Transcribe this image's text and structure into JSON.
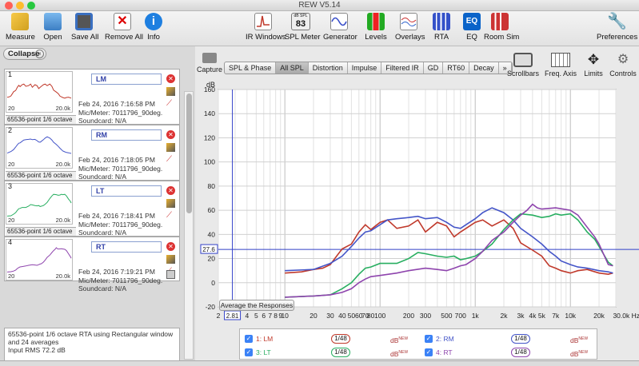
{
  "window": {
    "title": "REW V5.14"
  },
  "toolbar": {
    "measure": "Measure",
    "open": "Open",
    "save_all": "Save All",
    "remove_all": "Remove All",
    "info": "Info",
    "ir_windows": "IR Windows",
    "spl_meter": "SPL Meter",
    "spl_meter_value": "83",
    "spl_meter_unit": "dB SPL",
    "generator": "Generator",
    "levels": "Levels",
    "overlays": "Overlays",
    "rta": "RTA",
    "eq": "EQ",
    "eq_badge": "EQ",
    "room_sim": "Room Sim",
    "preferences": "Preferences"
  },
  "sidebar": {
    "collapse_label": "Collapse",
    "measurements": [
      {
        "index": "1",
        "name": "LM",
        "date": "Feb 24, 2016 7:16:58 PM",
        "mic": "Mic/Meter: 7011796_90deg.",
        "soundcard": "Soundcard: N/A",
        "desc": "65536-point 1/6 octave",
        "axis_lo": "20",
        "axis_hi": "20.0k",
        "color": "#c0392b"
      },
      {
        "index": "2",
        "name": "RM",
        "date": "Feb 24, 2016 7:18:05 PM",
        "mic": "Mic/Meter: 7011796_90deg.",
        "soundcard": "Soundcard: N/A",
        "desc": "65536-point 1/6 octave",
        "axis_lo": "20",
        "axis_hi": "20.0k",
        "color": "#4455c8"
      },
      {
        "index": "3",
        "name": "LT",
        "date": "Feb 24, 2016 7:18:41 PM",
        "mic": "Mic/Meter: 7011796_90deg.",
        "soundcard": "Soundcard: N/A",
        "desc": "65536-point 1/6 octave",
        "axis_lo": "20",
        "axis_hi": "20.0k",
        "color": "#27ae60"
      },
      {
        "index": "4",
        "name": "RT",
        "date": "Feb 24, 2016 7:19:21 PM",
        "mic": "Mic/Meter: 7011796_90deg.",
        "soundcard": "Soundcard: N/A",
        "axis_lo": "20",
        "axis_hi": "20.0k",
        "color": "#8e44ad"
      }
    ],
    "selected_info": {
      "line1": "65536-point 1/6 octave RTA using Rectangular window",
      "line2": "and 24 averages",
      "line3": "Input RMS 72.2 dB"
    }
  },
  "graph": {
    "capture": "Capture",
    "tabs": [
      "SPL & Phase",
      "All SPL",
      "Distortion",
      "Impulse",
      "Filtered IR",
      "GD",
      "RT60",
      "Decay",
      "»"
    ],
    "active_tab": "All SPL",
    "tools": {
      "scrollbars": "Scrollbars",
      "freq_axis": "Freq. Axis",
      "limits": "Limits",
      "controls": "Controls"
    },
    "cursor_y_label": "27.6",
    "cursor_x_label": "2.81",
    "average_button": "Average the Responses",
    "legend": [
      {
        "label": "1: LM",
        "smoothing": "1/48",
        "db": "dB",
        "db_sup": "NEW",
        "color": "#c0392b"
      },
      {
        "label": "2: RM",
        "smoothing": "1/48",
        "db": "dB",
        "db_sup": "NEW",
        "color": "#4455c8"
      },
      {
        "label": "3: LT",
        "smoothing": "1/48",
        "db": "dB",
        "db_sup": "NEW",
        "color": "#27ae60"
      },
      {
        "label": "4: RT",
        "smoothing": "1/48",
        "db": "dB",
        "db_sup": "NEW",
        "color": "#8e44ad"
      }
    ]
  },
  "chart_data": {
    "type": "line",
    "ylabel": "dB",
    "xlabel": "Hz",
    "xscale": "log",
    "xlim": [
      2,
      30000
    ],
    "ylim": [
      -20,
      160
    ],
    "grid": true,
    "x_ticks": [
      "2",
      "3",
      "4",
      "5",
      "6",
      "7",
      "8",
      "9",
      "10",
      "20",
      "30",
      "40",
      "50",
      "60",
      "70",
      "80",
      "100",
      "200",
      "300",
      "500",
      "700",
      "1k",
      "2k",
      "3k",
      "4k",
      "5k",
      "7k",
      "10k",
      "20k",
      "30.0k Hz"
    ],
    "y_ticks": [
      "160",
      "140",
      "120",
      "100",
      "80",
      "60",
      "40",
      "20",
      "0",
      "-20"
    ],
    "cursor": {
      "x": 2.81,
      "y": 27.6
    },
    "series": [
      {
        "name": "1: LM",
        "color": "#c0392b",
        "points": [
          [
            10,
            8
          ],
          [
            15,
            9
          ],
          [
            20,
            11
          ],
          [
            25,
            12
          ],
          [
            30,
            15
          ],
          [
            35,
            22
          ],
          [
            40,
            28
          ],
          [
            50,
            32
          ],
          [
            60,
            42
          ],
          [
            70,
            48
          ],
          [
            80,
            44
          ],
          [
            100,
            50
          ],
          [
            120,
            52
          ],
          [
            150,
            45
          ],
          [
            200,
            47
          ],
          [
            250,
            52
          ],
          [
            300,
            42
          ],
          [
            400,
            50
          ],
          [
            500,
            47
          ],
          [
            600,
            38
          ],
          [
            700,
            42
          ],
          [
            800,
            45
          ],
          [
            1000,
            50
          ],
          [
            1200,
            52
          ],
          [
            1500,
            47
          ],
          [
            2000,
            52
          ],
          [
            2500,
            45
          ],
          [
            3000,
            33
          ],
          [
            4000,
            27
          ],
          [
            5000,
            22
          ],
          [
            6000,
            14
          ],
          [
            7000,
            12
          ],
          [
            8000,
            10
          ],
          [
            10000,
            8
          ],
          [
            12000,
            10
          ],
          [
            15000,
            11
          ],
          [
            20000,
            8
          ],
          [
            25000,
            7
          ],
          [
            28000,
            8
          ]
        ]
      },
      {
        "name": "2: RM",
        "color": "#4455c8",
        "points": [
          [
            10,
            10
          ],
          [
            20,
            11
          ],
          [
            30,
            16
          ],
          [
            40,
            22
          ],
          [
            50,
            30
          ],
          [
            60,
            37
          ],
          [
            70,
            42
          ],
          [
            80,
            43
          ],
          [
            100,
            48
          ],
          [
            120,
            52
          ],
          [
            150,
            53
          ],
          [
            200,
            54
          ],
          [
            250,
            55
          ],
          [
            300,
            53
          ],
          [
            400,
            54
          ],
          [
            500,
            50
          ],
          [
            600,
            46
          ],
          [
            700,
            45
          ],
          [
            800,
            48
          ],
          [
            1000,
            53
          ],
          [
            1200,
            58
          ],
          [
            1500,
            62
          ],
          [
            2000,
            58
          ],
          [
            2500,
            52
          ],
          [
            3000,
            45
          ],
          [
            4000,
            38
          ],
          [
            5000,
            32
          ],
          [
            6000,
            26
          ],
          [
            7000,
            22
          ],
          [
            8000,
            18
          ],
          [
            10000,
            15
          ],
          [
            12000,
            13
          ],
          [
            15000,
            12
          ],
          [
            20000,
            10
          ],
          [
            25000,
            9
          ],
          [
            28000,
            8
          ]
        ]
      },
      {
        "name": "3: LT",
        "color": "#27ae60",
        "points": [
          [
            10,
            -12
          ],
          [
            20,
            -11
          ],
          [
            30,
            -10
          ],
          [
            40,
            -5
          ],
          [
            50,
            0
          ],
          [
            60,
            7
          ],
          [
            70,
            12
          ],
          [
            80,
            13
          ],
          [
            100,
            16
          ],
          [
            150,
            16
          ],
          [
            200,
            20
          ],
          [
            250,
            25
          ],
          [
            300,
            24
          ],
          [
            400,
            22
          ],
          [
            500,
            21
          ],
          [
            600,
            22
          ],
          [
            700,
            19
          ],
          [
            800,
            20
          ],
          [
            1000,
            22
          ],
          [
            1200,
            26
          ],
          [
            1500,
            32
          ],
          [
            2000,
            44
          ],
          [
            2500,
            52
          ],
          [
            3000,
            57
          ],
          [
            4000,
            56
          ],
          [
            5000,
            54
          ],
          [
            6000,
            55
          ],
          [
            7000,
            57
          ],
          [
            8000,
            56
          ],
          [
            10000,
            57
          ],
          [
            12000,
            52
          ],
          [
            15000,
            42
          ],
          [
            18000,
            36
          ],
          [
            20000,
            30
          ],
          [
            25000,
            17
          ],
          [
            28000,
            14
          ]
        ]
      },
      {
        "name": "4: RT",
        "color": "#8e44ad",
        "points": [
          [
            10,
            -12
          ],
          [
            20,
            -11
          ],
          [
            30,
            -10
          ],
          [
            40,
            -8
          ],
          [
            50,
            -5
          ],
          [
            60,
            0
          ],
          [
            70,
            3
          ],
          [
            80,
            5
          ],
          [
            100,
            6
          ],
          [
            150,
            8
          ],
          [
            200,
            10
          ],
          [
            300,
            12
          ],
          [
            400,
            11
          ],
          [
            500,
            10
          ],
          [
            600,
            12
          ],
          [
            700,
            14
          ],
          [
            800,
            15
          ],
          [
            1000,
            20
          ],
          [
            1200,
            26
          ],
          [
            1500,
            35
          ],
          [
            2000,
            42
          ],
          [
            2500,
            50
          ],
          [
            3000,
            56
          ],
          [
            3500,
            60
          ],
          [
            4000,
            65
          ],
          [
            4500,
            62
          ],
          [
            5000,
            61
          ],
          [
            7000,
            62
          ],
          [
            10000,
            60
          ],
          [
            12000,
            56
          ],
          [
            15000,
            46
          ],
          [
            18000,
            38
          ],
          [
            20000,
            32
          ],
          [
            25000,
            15
          ],
          [
            28000,
            14
          ]
        ]
      }
    ]
  }
}
